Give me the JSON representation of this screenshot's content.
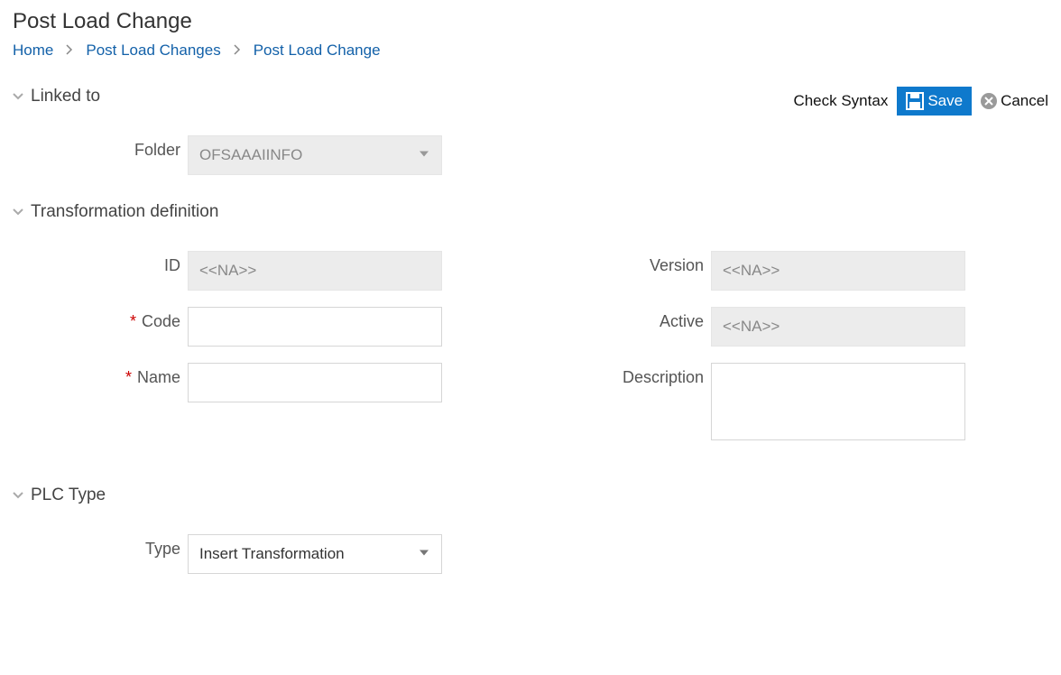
{
  "title": "Post Load Change",
  "breadcrumbs": {
    "item0": "Home",
    "item1": "Post Load Changes",
    "item2": "Post Load Change"
  },
  "actions": {
    "check_syntax": "Check Syntax",
    "save": "Save",
    "cancel": "Cancel"
  },
  "sections": {
    "linked_to": {
      "title": "Linked to",
      "fields": {
        "folder_label": "Folder",
        "folder_value": "OFSAAAIINFO"
      }
    },
    "transformation": {
      "title": "Transformation definition",
      "fields": {
        "id_label": "ID",
        "id_value": "<<NA>>",
        "code_label": "Code",
        "code_value": "",
        "name_label": "Name",
        "name_value": "",
        "version_label": "Version",
        "version_value": "<<NA>>",
        "active_label": "Active",
        "active_value": "<<NA>>",
        "description_label": "Description",
        "description_value": ""
      }
    },
    "plc_type": {
      "title": "PLC Type",
      "fields": {
        "type_label": "Type",
        "type_value": "Insert Transformation"
      }
    }
  },
  "required_marker": "*"
}
